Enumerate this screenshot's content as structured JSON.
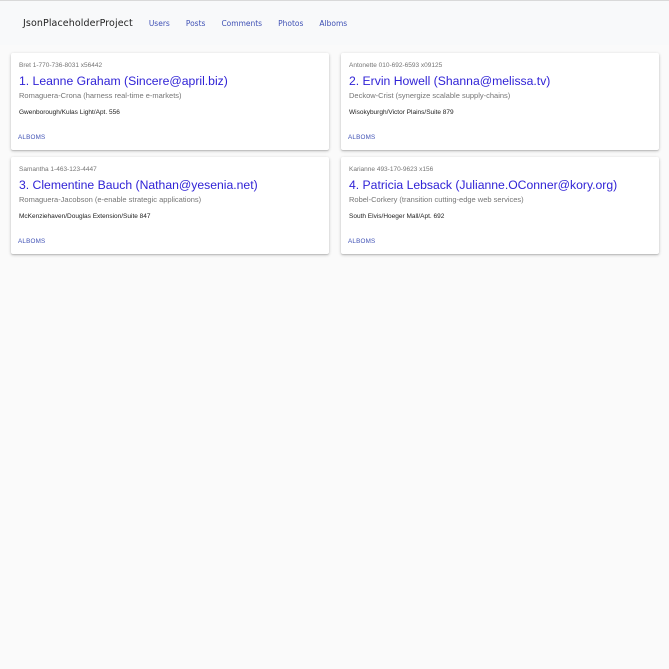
{
  "navbar": {
    "brand": "JsonPlaceholderProject",
    "links": [
      "Users",
      "Posts",
      "Comments",
      "Photos",
      "Alboms"
    ]
  },
  "users": [
    {
      "meta": "Bret 1-770-736-8031 x56442",
      "title": "1. Leanne Graham (Sincere@april.biz)",
      "company": "Romaguera-Crona (harness real-time e-markets)",
      "address": "Gwenborough/Kulas Light/Apt. 556",
      "action": "ALBOMS"
    },
    {
      "meta": "Antonette 010-692-6593 x09125",
      "title": "2. Ervin Howell (Shanna@melissa.tv)",
      "company": "Deckow-Crist (synergize scalable supply-chains)",
      "address": "Wisokyburgh/Victor Plains/Suite 879",
      "action": "ALBOMS"
    },
    {
      "meta": "Samantha 1-463-123-4447",
      "title": "3. Clementine Bauch (Nathan@yesenia.net)",
      "company": "Romaguera-Jacobson (e-enable strategic applications)",
      "address": "McKenziehaven/Douglas Extension/Suite 847",
      "action": "ALBOMS"
    },
    {
      "meta": "Karianne 493-170-9623 x156",
      "title": "4. Patricia Lebsack (Julianne.OConner@kory.org)",
      "company": "Robel-Corkery (transition cutting-edge web services)",
      "address": "South Elvis/Hoeger Mall/Apt. 692",
      "action": "ALBOMS"
    }
  ],
  "colors": {
    "accent": "#3f51b5",
    "title": "#3023d6",
    "page_background": "#fafafa",
    "navbar_background": "#f8f9fa"
  }
}
